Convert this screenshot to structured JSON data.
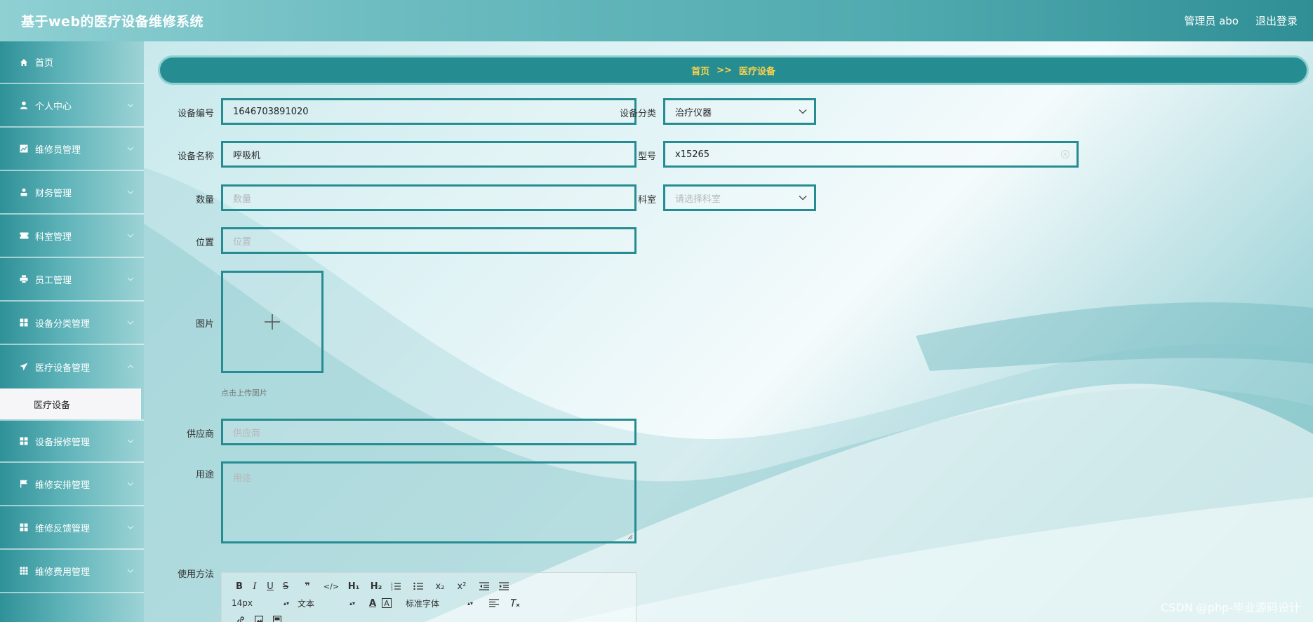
{
  "header": {
    "title": "基于web的医疗设备维修系统",
    "user_label": "管理员 abo",
    "logout_label": "退出登录"
  },
  "sidebar": {
    "items": [
      {
        "label": "首页",
        "icon": "home-icon"
      },
      {
        "label": "个人中心",
        "icon": "user-icon"
      },
      {
        "label": "维修员管理",
        "icon": "chart-icon"
      },
      {
        "label": "财务管理",
        "icon": "person-icon"
      },
      {
        "label": "科室管理",
        "icon": "ticket-icon"
      },
      {
        "label": "员工管理",
        "icon": "printer-icon"
      },
      {
        "label": "设备分类管理",
        "icon": "grid-icon"
      },
      {
        "label": "医疗设备管理",
        "icon": "send-icon"
      },
      {
        "label": "设备报修管理",
        "icon": "grid-icon"
      },
      {
        "label": "维修安排管理",
        "icon": "flag-icon"
      },
      {
        "label": "维修反馈管理",
        "icon": "grid-icon"
      },
      {
        "label": "维修费用管理",
        "icon": "apps-icon"
      }
    ],
    "active_submenu": "医疗设备"
  },
  "breadcrumb": {
    "home": "首页",
    "separator": ">>",
    "current": "医疗设备"
  },
  "form": {
    "device_no": {
      "label": "设备编号",
      "value": "1646703891020"
    },
    "device_name": {
      "label": "设备名称",
      "value": "呼吸机"
    },
    "quantity": {
      "label": "数量",
      "placeholder": "数量"
    },
    "location": {
      "label": "位置",
      "placeholder": "位置"
    },
    "image": {
      "label": "图片",
      "hint": "点击上传图片"
    },
    "supplier": {
      "label": "供应商",
      "placeholder": "供应商"
    },
    "purpose": {
      "label": "用途",
      "placeholder": "用途"
    },
    "usage": {
      "label": "使用方法"
    },
    "category": {
      "label": "设备分类",
      "value": "治疗仪器"
    },
    "model": {
      "label": "型号",
      "value": "x15265"
    },
    "department": {
      "label": "科室",
      "placeholder": "请选择科室"
    }
  },
  "editor": {
    "font_size": "14px",
    "paragraph": "文本",
    "font_family": "标准字体"
  },
  "watermark": "CSDN @php-毕业源码设计",
  "colors": {
    "accent": "#258d92",
    "breadcrumb_text": "#ffd24a",
    "header_bg": "#4ea9ae"
  }
}
